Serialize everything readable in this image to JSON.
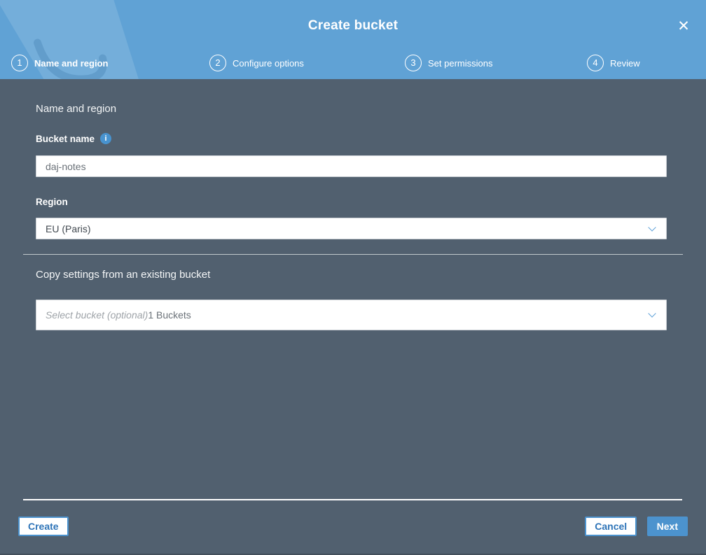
{
  "modal": {
    "title": "Create bucket",
    "close_icon": "✕"
  },
  "steps": [
    {
      "number": "1",
      "label": "Name and region",
      "active": true
    },
    {
      "number": "2",
      "label": "Configure options",
      "active": false
    },
    {
      "number": "3",
      "label": "Set permissions",
      "active": false
    },
    {
      "number": "4",
      "label": "Review",
      "active": false
    }
  ],
  "form": {
    "section_heading": "Name and region",
    "bucket_name_label": "Bucket name",
    "bucket_name_info_icon": "i",
    "bucket_name_value": "daj-notes",
    "region_label": "Region",
    "region_value": "EU (Paris)",
    "copy_heading": "Copy settings from an existing bucket",
    "bucket_select_placeholder": "Select bucket (optional)",
    "bucket_select_count": "1 Buckets"
  },
  "footer": {
    "create_label": "Create",
    "cancel_label": "Cancel",
    "next_label": "Next"
  },
  "colors": {
    "header_blue": "#60A2D5",
    "body_slate": "#51606F",
    "button_blue": "#4C93CE",
    "button_text_blue": "#2E74B8",
    "info_icon_blue": "#4893CF"
  }
}
